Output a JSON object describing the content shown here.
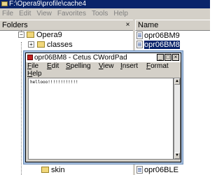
{
  "explorer": {
    "title": "F:\\Opera9\\profile\\cache4",
    "menu": [
      "File",
      "Edit",
      "View",
      "Favorites",
      "Tools",
      "Help"
    ],
    "folders_header": "Folders",
    "folders_close": "×",
    "name_header": "Name",
    "tree": [
      {
        "label": "Opera9",
        "expander": "−"
      },
      {
        "label": "classes",
        "expander": "+"
      },
      {
        "label": "skin",
        "expander": ""
      }
    ],
    "files": [
      {
        "label": "opr06BM9",
        "selected": false
      },
      {
        "label": "opr06BM8",
        "selected": true
      },
      {
        "label": "opr06BLE",
        "selected": false
      }
    ]
  },
  "wordpad": {
    "title": "opr06BM8 - Cetus CWordPad",
    "controls": {
      "minimize": "_",
      "maximize": "□",
      "close": "×"
    },
    "menu": [
      "File",
      "Edit",
      "Spelling",
      "View",
      "Insert",
      "Format",
      "Help"
    ],
    "document_text": "hellooo!!!!!!!!!!!!",
    "scroll_up": "▲",
    "scroll_down": "▼"
  }
}
